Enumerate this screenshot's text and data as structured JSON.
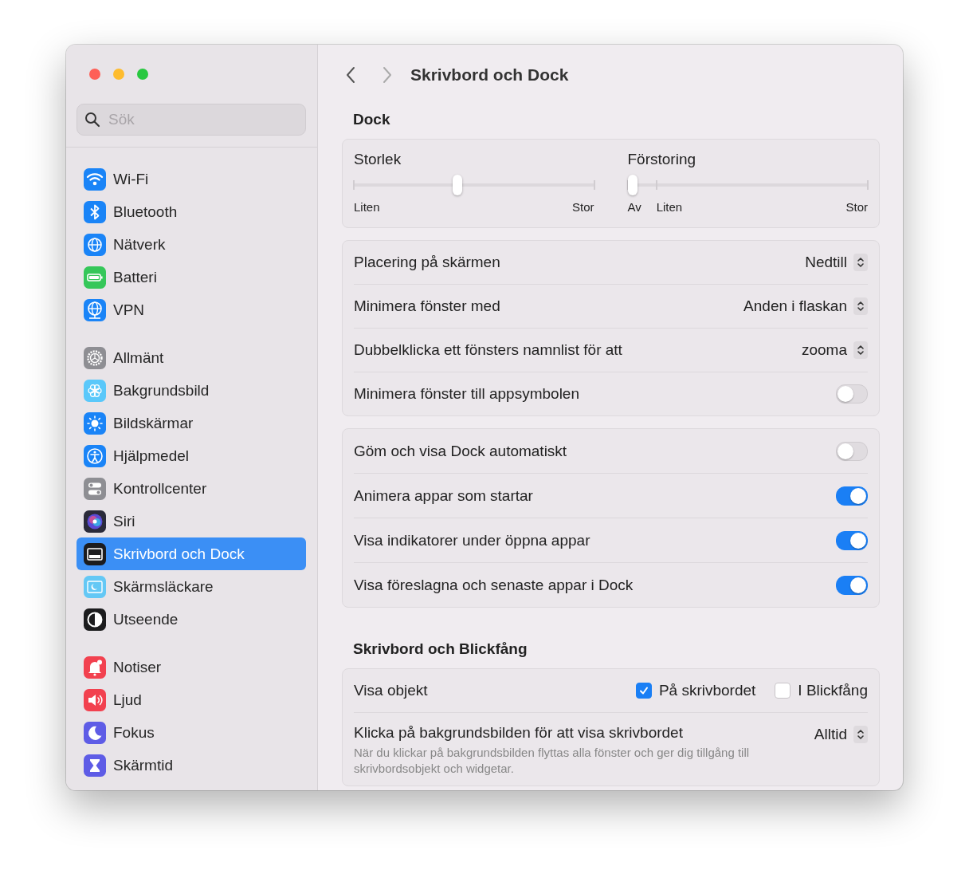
{
  "sidebar": {
    "search": {
      "placeholder": "Sök"
    },
    "groups": [
      [
        {
          "label": "Wi-Fi",
          "color": "#1a84f7",
          "selected": false
        },
        {
          "label": "Bluetooth",
          "color": "#1a84f7",
          "selected": false
        },
        {
          "label": "Nätverk",
          "color": "#1a84f7",
          "selected": false
        },
        {
          "label": "Batteri",
          "color": "#35c759",
          "selected": false
        },
        {
          "label": "VPN",
          "color": "#1a84f7",
          "selected": false
        }
      ],
      [
        {
          "label": "Allmänt",
          "color": "#8e8e93",
          "selected": false
        },
        {
          "label": "Bakgrundsbild",
          "color": "#5ac8fa",
          "selected": false
        },
        {
          "label": "Bildskärmar",
          "color": "#1a84f7",
          "selected": false
        },
        {
          "label": "Hjälpmedel",
          "color": "#1a84f7",
          "selected": false
        },
        {
          "label": "Kontrollcenter",
          "color": "#8e8e93",
          "selected": false
        },
        {
          "label": "Siri",
          "color": "#2a2a3a",
          "selected": false
        },
        {
          "label": "Skrivbord och Dock",
          "color": "#1c1c1e",
          "selected": true
        },
        {
          "label": "Skärmsläckare",
          "color": "#64c8f5",
          "selected": false
        },
        {
          "label": "Utseende",
          "color": "#1c1c1e",
          "selected": false
        }
      ],
      [
        {
          "label": "Notiser",
          "color": "#f2414f",
          "selected": false
        },
        {
          "label": "Ljud",
          "color": "#f2414f",
          "selected": false
        },
        {
          "label": "Fokus",
          "color": "#5e5ce6",
          "selected": false
        },
        {
          "label": "Skärmtid",
          "color": "#5e5ce6",
          "selected": false
        }
      ]
    ]
  },
  "header": {
    "title": "Skrivbord och Dock"
  },
  "dock": {
    "title": "Dock",
    "sliders": [
      {
        "label": "Storlek",
        "level": 0.43,
        "marks": [
          "Liten",
          "Stor"
        ]
      },
      {
        "label": "Förstoring",
        "level": 0,
        "marks": [
          "Av",
          "Liten",
          "Stor"
        ]
      }
    ],
    "cards": [
      [
        {
          "kind": "popup",
          "label": "Placering på skärmen",
          "value": "Nedtill"
        },
        {
          "kind": "popup",
          "label": "Minimera fönster med",
          "value": "Anden i flaskan"
        },
        {
          "kind": "popup",
          "label": "Dubbelklicka ett fönsters namnlist för att",
          "value": "zooma"
        },
        {
          "kind": "toggle",
          "label": "Minimera fönster till appsymbolen",
          "on": false
        }
      ],
      [
        {
          "kind": "toggle",
          "label": "Göm och visa Dock automatiskt",
          "on": false
        },
        {
          "kind": "toggle",
          "label": "Animera appar som startar",
          "on": true
        },
        {
          "kind": "toggle",
          "label": "Visa indikatorer under öppna appar",
          "on": true
        },
        {
          "kind": "toggle",
          "label": "Visa föreslagna och senaste appar i Dock",
          "on": true
        }
      ]
    ]
  },
  "desktop": {
    "title": "Skrivbord och Blickfång",
    "rows": [
      {
        "kind": "checks",
        "label": "Visa objekt",
        "options": [
          {
            "label": "På skrivbordet",
            "checked": true
          },
          {
            "label": "I Blickfång",
            "checked": false
          }
        ]
      },
      {
        "kind": "popup",
        "label": "Klicka på bakgrundsbilden för att visa skrivbordet",
        "value": "Alltid",
        "description": "När du klickar på bakgrundsbilden flyttas alla fönster och ger dig tillgång till skrivbordsobjekt och widgetar."
      }
    ]
  }
}
